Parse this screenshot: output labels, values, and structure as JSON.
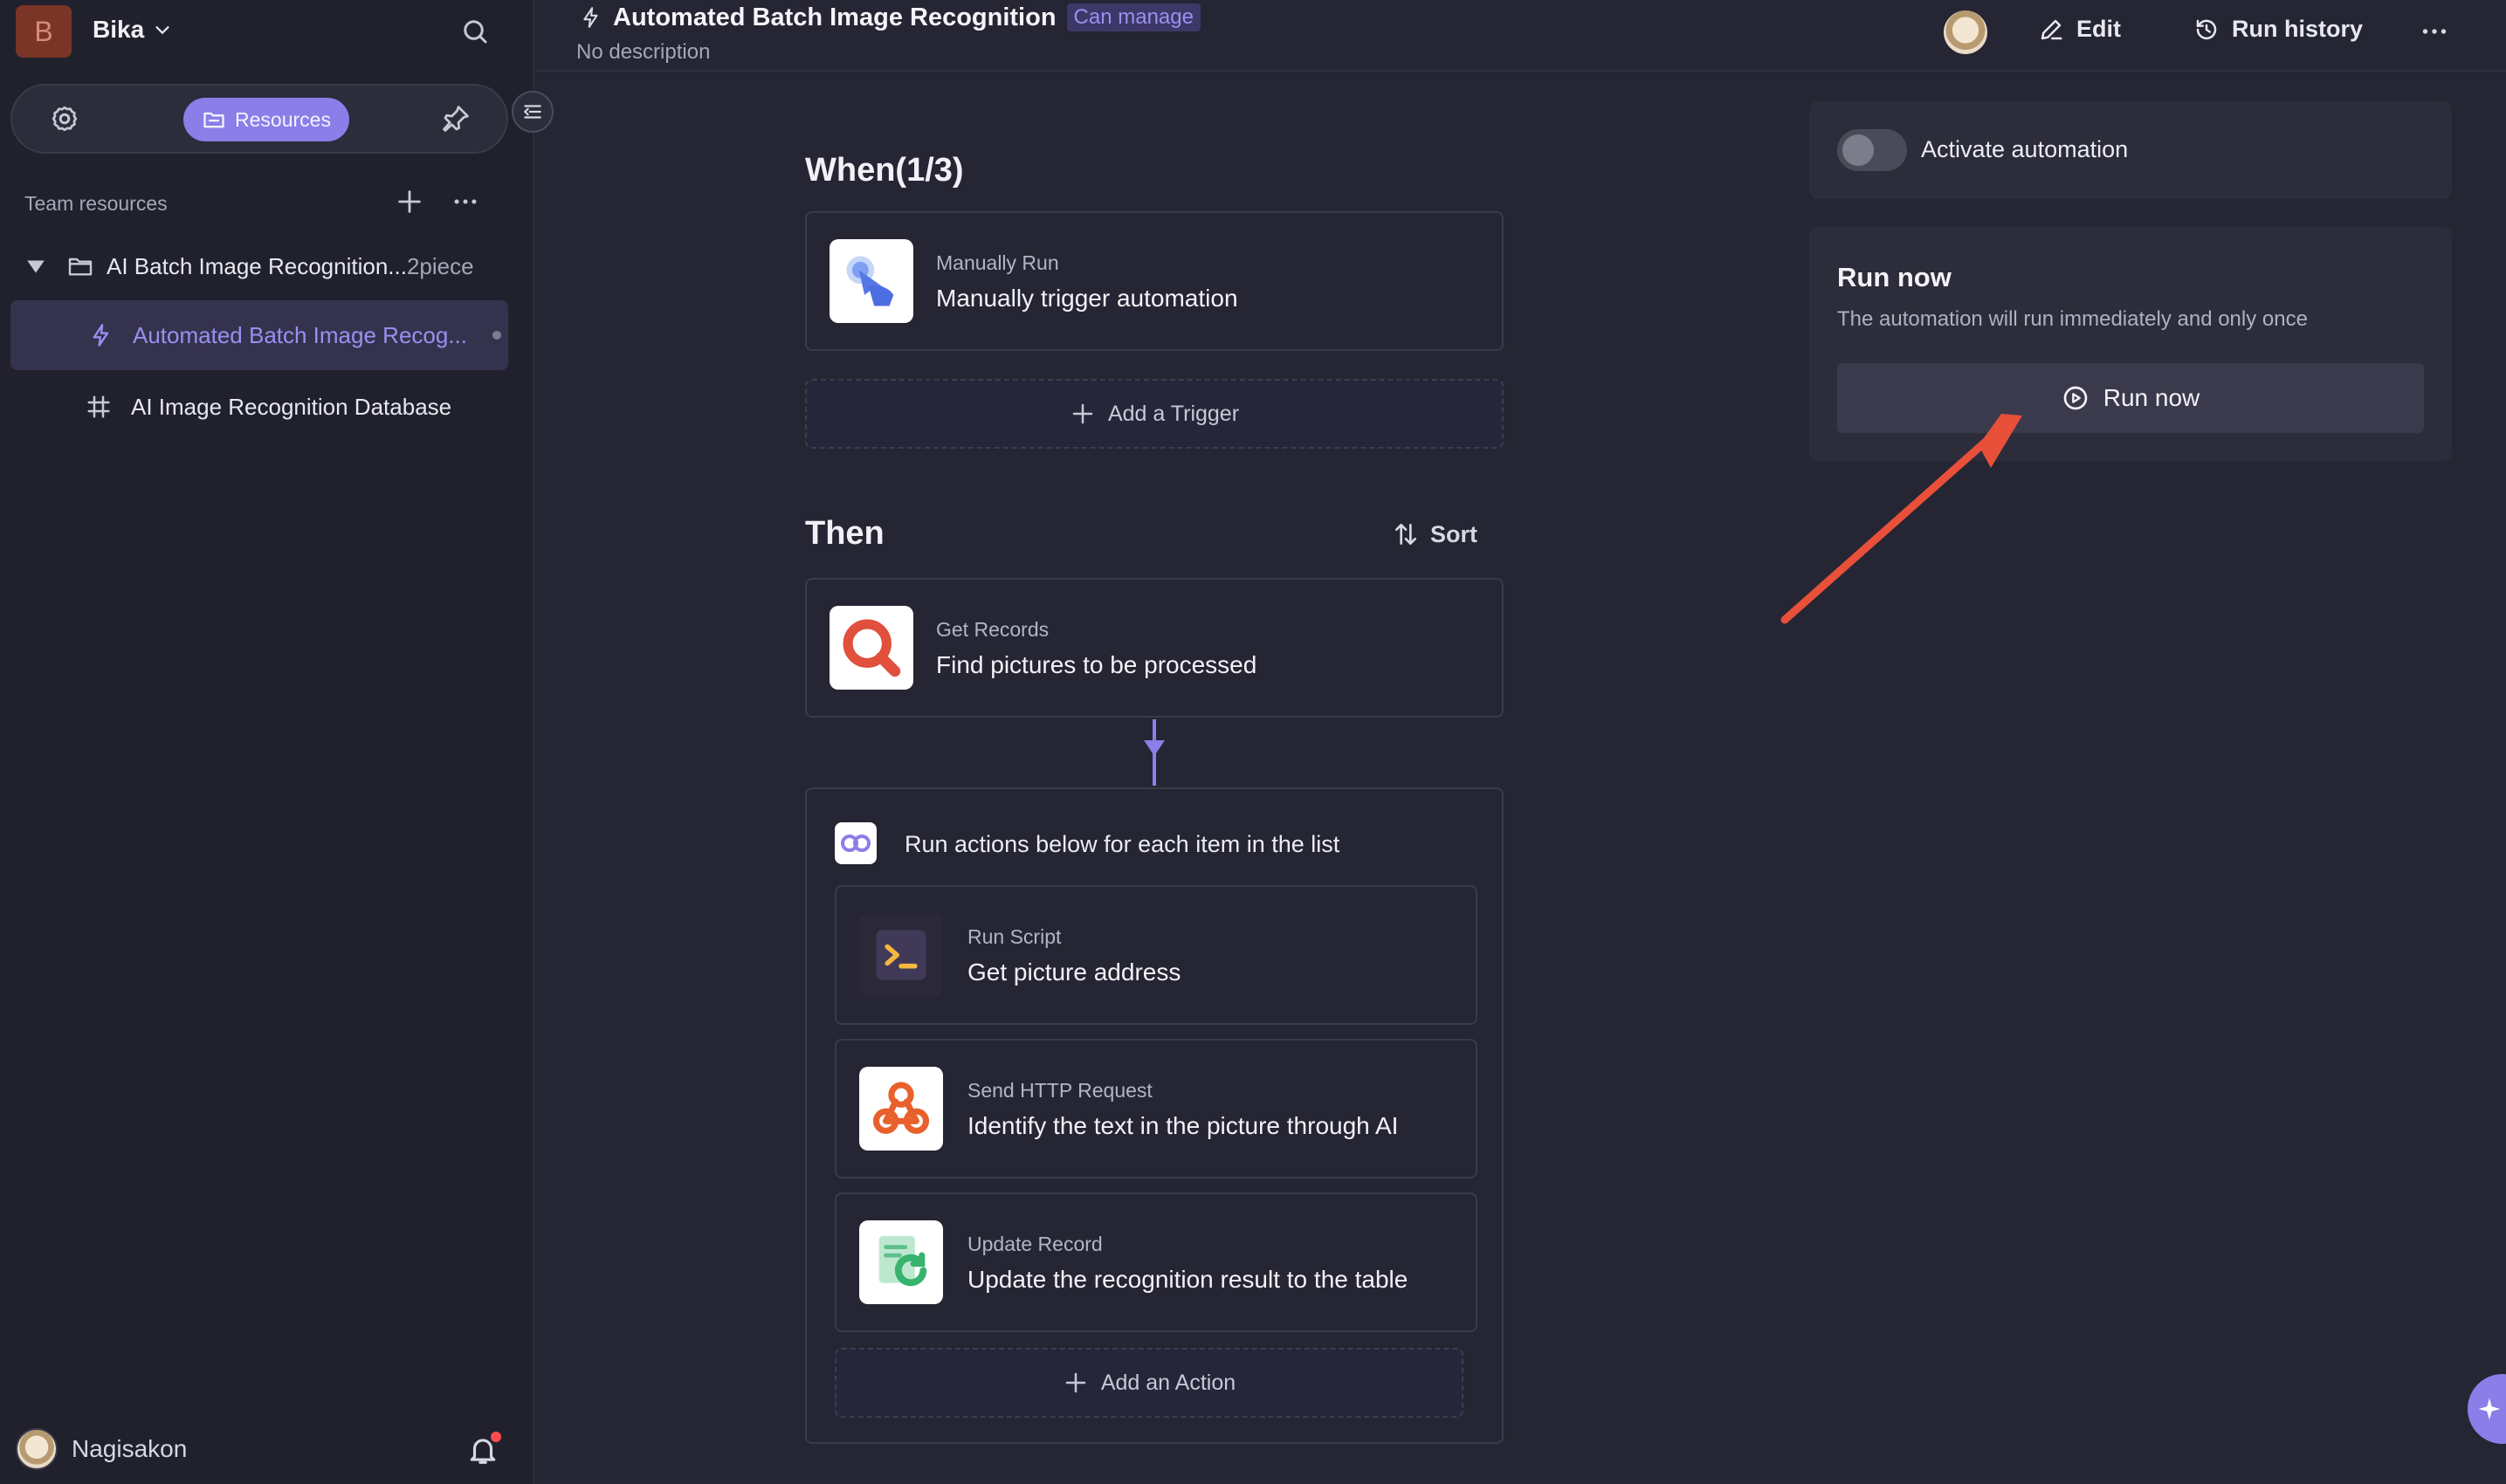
{
  "workspace": {
    "initial": "B",
    "name": "Bika"
  },
  "sidebar": {
    "tabs": {
      "active_label": "Resources"
    },
    "team_resources_label": "Team resources",
    "folder": {
      "label": "AI Batch Image Recognition...",
      "count": "2piece"
    },
    "items": [
      {
        "label": "Automated Batch Image Recog..."
      },
      {
        "label": "AI Image Recognition Database"
      }
    ],
    "user_name": "Nagisakon"
  },
  "header": {
    "title": "Automated Batch Image Recognition",
    "permission": "Can manage",
    "description": "No description",
    "edit_label": "Edit",
    "run_history_label": "Run history"
  },
  "when": {
    "title": "When(1/3)",
    "trigger": {
      "sub": "Manually Run",
      "main": "Manually trigger automation"
    },
    "add_trigger_label": "Add a Trigger"
  },
  "then": {
    "title": "Then",
    "sort_label": "Sort",
    "get_records": {
      "sub": "Get Records",
      "main": "Find pictures to be processed"
    },
    "loop": {
      "title": "Run actions below for each item in the list",
      "actions": [
        {
          "sub": "Run Script",
          "main": "Get picture address"
        },
        {
          "sub": "Send HTTP Request",
          "main": "Identify the text in the picture through AI"
        },
        {
          "sub": "Update Record",
          "main": "Update the recognition result to the table"
        }
      ],
      "add_action_label": "Add an Action"
    }
  },
  "panel": {
    "activate_label": "Activate automation",
    "run_now_title": "Run now",
    "run_now_desc": "The automation will run immediately and only once",
    "run_now_button": "Run now"
  },
  "colors": {
    "accent": "#8b7ee8",
    "annotation_arrow": "#e8503a"
  }
}
